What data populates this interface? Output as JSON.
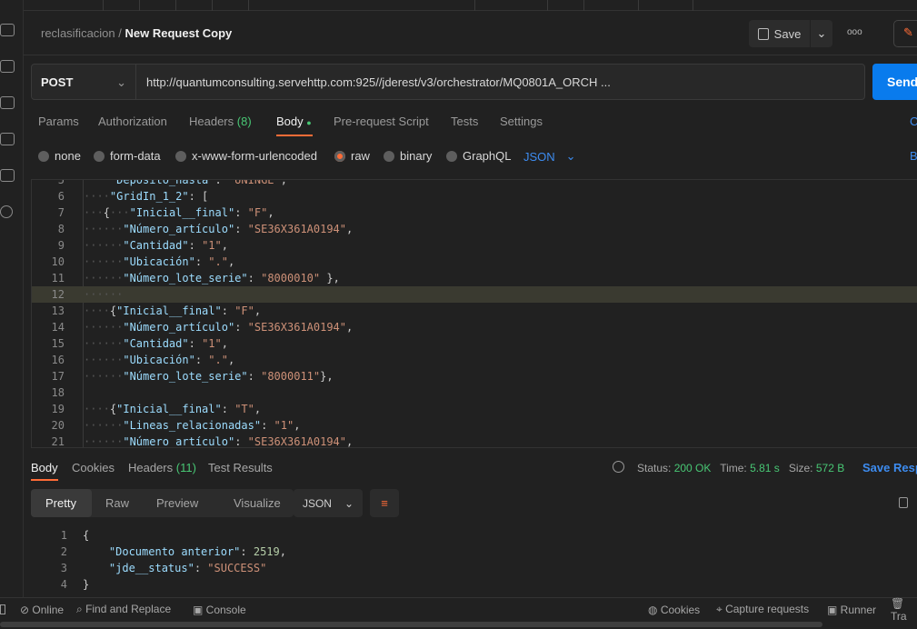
{
  "breadcrumb": {
    "collection": "reclasificacion",
    "separator": "/",
    "request": "New Request Copy"
  },
  "toolbar": {
    "save": "Save",
    "more": "ooo"
  },
  "request": {
    "method": "POST",
    "url": "http://quantumconsulting.servehttp.com:925//jderest/v3/orchestrator/MQ0801A_ORCH ...",
    "send": "Send"
  },
  "tabs": [
    {
      "label": "Params"
    },
    {
      "label": "Authorization"
    },
    {
      "label": "Headers",
      "count": "(8)"
    },
    {
      "label": "Body"
    },
    {
      "label": "Pre-request Script"
    },
    {
      "label": "Tests"
    },
    {
      "label": "Settings"
    }
  ],
  "tabs_right": "C",
  "body_types": [
    "none",
    "form-data",
    "x-www-form-urlencoded",
    "raw",
    "binary",
    "GraphQL"
  ],
  "body_selected": "raw",
  "body_format": "JSON",
  "beautify": "B",
  "editor_lines": [
    {
      "n": "5",
      "parts": [
        [
          "w",
          "    "
        ],
        [
          "k",
          "\"Deposito_hasta\""
        ],
        [
          "p",
          ": "
        ],
        [
          "s",
          "\"UNINGE\""
        ],
        [
          "p",
          ","
        ]
      ]
    },
    {
      "n": "6",
      "parts": [
        [
          "w",
          "····"
        ],
        [
          "k",
          "\"GridIn_1_2\""
        ],
        [
          "p",
          ": ["
        ]
      ]
    },
    {
      "n": "7",
      "parts": [
        [
          "w",
          "···"
        ],
        [
          "p",
          "{"
        ],
        [
          "w",
          "···"
        ],
        [
          "k",
          "\"Inicial__final\""
        ],
        [
          "p",
          ": "
        ],
        [
          "s",
          "\"F\""
        ],
        [
          "p",
          ","
        ]
      ]
    },
    {
      "n": "8",
      "parts": [
        [
          "w",
          "······"
        ],
        [
          "k",
          "\"Número_artículo\""
        ],
        [
          "p",
          ": "
        ],
        [
          "s",
          "\"SE36X361A0194\""
        ],
        [
          "p",
          ","
        ]
      ]
    },
    {
      "n": "9",
      "parts": [
        [
          "w",
          "······"
        ],
        [
          "k",
          "\"Cantidad\""
        ],
        [
          "p",
          ": "
        ],
        [
          "s",
          "\"1\""
        ],
        [
          "p",
          ","
        ]
      ]
    },
    {
      "n": "10",
      "parts": [
        [
          "w",
          "······"
        ],
        [
          "k",
          "\"Ubicación\""
        ],
        [
          "p",
          ": "
        ],
        [
          "s",
          "\".\""
        ],
        [
          "p",
          ","
        ]
      ]
    },
    {
      "n": "11",
      "parts": [
        [
          "w",
          "······"
        ],
        [
          "k",
          "\"Número_lote_serie\""
        ],
        [
          "p",
          ": "
        ],
        [
          "s",
          "\"8000010\""
        ],
        [
          "p",
          " },"
        ]
      ]
    },
    {
      "n": "12",
      "parts": [
        [
          "w",
          "······"
        ]
      ]
    },
    {
      "n": "13",
      "parts": [
        [
          "w",
          "····"
        ],
        [
          "p",
          "{"
        ],
        [
          "k",
          "\"Inicial__final\""
        ],
        [
          "p",
          ": "
        ],
        [
          "s",
          "\"F\""
        ],
        [
          "p",
          ","
        ]
      ]
    },
    {
      "n": "14",
      "parts": [
        [
          "w",
          "······"
        ],
        [
          "k",
          "\"Número_artículo\""
        ],
        [
          "p",
          ": "
        ],
        [
          "s",
          "\"SE36X361A0194\""
        ],
        [
          "p",
          ","
        ]
      ]
    },
    {
      "n": "15",
      "parts": [
        [
          "w",
          "······"
        ],
        [
          "k",
          "\"Cantidad\""
        ],
        [
          "p",
          ": "
        ],
        [
          "s",
          "\"1\""
        ],
        [
          "p",
          ","
        ]
      ]
    },
    {
      "n": "16",
      "parts": [
        [
          "w",
          "······"
        ],
        [
          "k",
          "\"Ubicación\""
        ],
        [
          "p",
          ": "
        ],
        [
          "s",
          "\".\""
        ],
        [
          "p",
          ","
        ]
      ]
    },
    {
      "n": "17",
      "parts": [
        [
          "w",
          "······"
        ],
        [
          "k",
          "\"Número_lote_serie\""
        ],
        [
          "p",
          ": "
        ],
        [
          "s",
          "\"8000011\""
        ],
        [
          "p",
          "},"
        ]
      ]
    },
    {
      "n": "18",
      "parts": []
    },
    {
      "n": "19",
      "parts": [
        [
          "w",
          "····"
        ],
        [
          "p",
          "{"
        ],
        [
          "k",
          "\"Inicial__final\""
        ],
        [
          "p",
          ": "
        ],
        [
          "s",
          "\"T\""
        ],
        [
          "p",
          ","
        ]
      ]
    },
    {
      "n": "20",
      "parts": [
        [
          "w",
          "······"
        ],
        [
          "k",
          "\"Lineas_relacionadas\""
        ],
        [
          "p",
          ": "
        ],
        [
          "s",
          "\"1\""
        ],
        [
          "p",
          ","
        ]
      ]
    },
    {
      "n": "21",
      "parts": [
        [
          "w",
          "······"
        ],
        [
          "k",
          "\"Número_artículo\""
        ],
        [
          "p",
          ": "
        ],
        [
          "s",
          "\"SE36X361A0194\""
        ],
        [
          "p",
          ","
        ]
      ]
    }
  ],
  "response": {
    "tabs": [
      {
        "label": "Body"
      },
      {
        "label": "Cookies"
      },
      {
        "label": "Headers",
        "count": "(11)"
      },
      {
        "label": "Test Results"
      }
    ],
    "status_label": "Status:",
    "status": "200 OK",
    "time_label": "Time:",
    "time": "5.81 s",
    "size_label": "Size:",
    "size": "572 B",
    "save": "Save Resp",
    "views": [
      "Pretty",
      "Raw",
      "Preview",
      "Visualize"
    ],
    "format": "JSON",
    "lines": [
      {
        "n": "1",
        "parts": [
          [
            "p",
            "{"
          ]
        ]
      },
      {
        "n": "2",
        "parts": [
          [
            "w",
            "    "
          ],
          [
            "k",
            "\"Documento anterior\""
          ],
          [
            "p",
            ": "
          ],
          [
            "n",
            "2519"
          ],
          [
            "p",
            ","
          ]
        ]
      },
      {
        "n": "3",
        "parts": [
          [
            "w",
            "    "
          ],
          [
            "k",
            "\"jde__status\""
          ],
          [
            "p",
            ": "
          ],
          [
            "s",
            "\"SUCCESS\""
          ]
        ]
      },
      {
        "n": "4",
        "parts": [
          [
            "p",
            "}"
          ]
        ]
      }
    ]
  },
  "statusbar": {
    "online": "Online",
    "find": "Find and Replace",
    "console": "Console",
    "cookies": "Cookies",
    "capture": "Capture requests",
    "runner": "Runner",
    "trash": "Tra"
  },
  "colors": {
    "accent": "#ff6c37",
    "send": "#097bed",
    "success": "#48c774",
    "link": "#3d8cf0"
  }
}
